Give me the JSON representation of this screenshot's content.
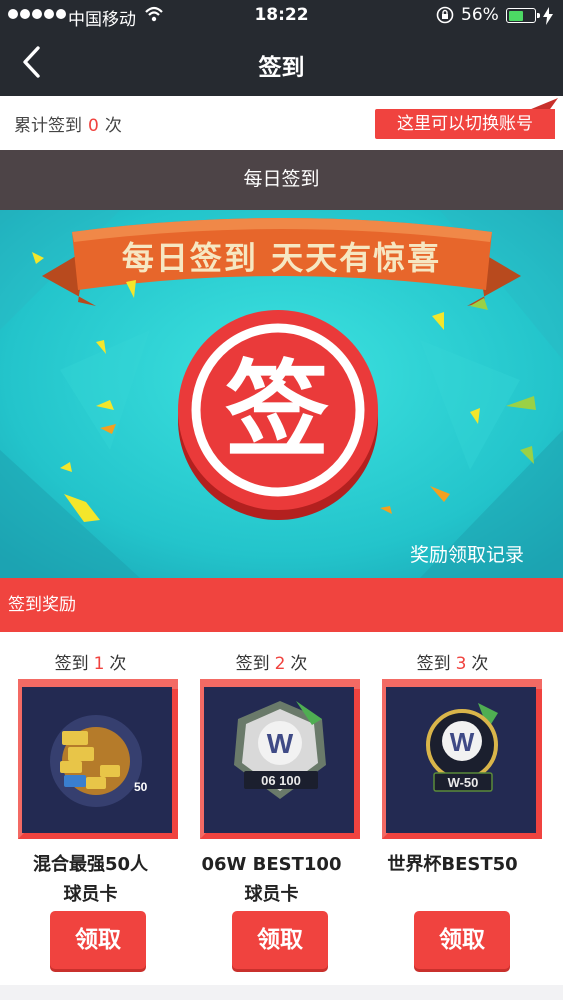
{
  "status_bar": {
    "carrier": "中国移动",
    "time": "18:22",
    "battery": "56%",
    "battery_level": 0.56
  },
  "nav": {
    "title": "签到"
  },
  "summary": {
    "prefix": "累计签到",
    "count": "0",
    "suffix": "次",
    "switch_account": "这里可以切换账号"
  },
  "daily": {
    "header": "每日签到",
    "slogan": "每日签到  天天有惊喜",
    "sign_button": "签",
    "record_link": "奖励领取记录"
  },
  "rewards": {
    "header": "签到奖励",
    "items": [
      {
        "times_prefix": "签到",
        "times": "1",
        "times_suffix": "次",
        "name_line1": "混合最强50人",
        "name_line2": "球员卡",
        "claim": "领取",
        "badge": "50"
      },
      {
        "times_prefix": "签到",
        "times": "2",
        "times_suffix": "次",
        "name_line1": "06W BEST100",
        "name_line2": "球员卡",
        "claim": "领取",
        "badge": "06 100"
      },
      {
        "times_prefix": "签到",
        "times": "3",
        "times_suffix": "次",
        "name_line1": "世界杯BEST50",
        "name_line2": "",
        "claim": "领取",
        "badge": "W-50"
      }
    ]
  },
  "colors": {
    "accent": "#f0433f",
    "nav_bg": "#262a30",
    "daily_bar": "#4d4447",
    "banner_teal": "#2fd0d0"
  }
}
